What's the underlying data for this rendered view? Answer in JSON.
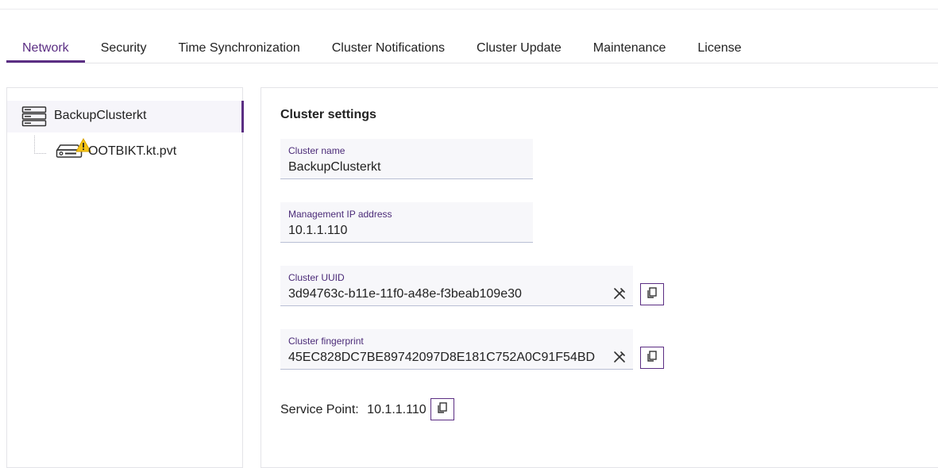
{
  "tabs": [
    {
      "label": "Network",
      "active": true
    },
    {
      "label": "Security",
      "active": false
    },
    {
      "label": "Time Synchronization",
      "active": false
    },
    {
      "label": "Cluster Notifications",
      "active": false
    },
    {
      "label": "Cluster Update",
      "active": false
    },
    {
      "label": "Maintenance",
      "active": false
    },
    {
      "label": "License",
      "active": false
    }
  ],
  "tree": {
    "root": {
      "label": "BackupClusterkt",
      "icon": "server-stack-icon"
    },
    "child": {
      "label": "OOTBIKT.kt.pvt",
      "icon": "appliance-icon",
      "badge_icon": "warning-icon"
    }
  },
  "settings": {
    "title": "Cluster settings",
    "cluster_name": {
      "label": "Cluster name",
      "value": "BackupClusterkt"
    },
    "management_ip": {
      "label": "Management IP address",
      "value": "10.1.1.110"
    },
    "cluster_uuid": {
      "label": "Cluster UUID",
      "value": "3d94763c-b11e-11f0-a48e-f3beab109e30"
    },
    "cluster_fingerprint": {
      "label": "Cluster fingerprint",
      "value": "45EC828DC7BE89742097D8E181C752A0C91F54BD"
    },
    "service_point": {
      "label": "Service Point:",
      "value": "10.1.1.110"
    }
  },
  "colors": {
    "accent": "#5b2e83",
    "field_bg": "#f7f7fa",
    "warning": "#f5c518"
  }
}
